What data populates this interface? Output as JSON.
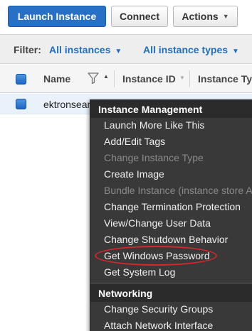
{
  "toolbar": {
    "launch_label": "Launch Instance",
    "connect_label": "Connect",
    "actions_label": "Actions",
    "actions_caret_icon": "chevron-down-icon"
  },
  "filter_bar": {
    "label": "Filter:",
    "instances_filter": "All instances",
    "types_filter": "All instance types",
    "chevron_icon": "chevron-down-icon"
  },
  "table": {
    "columns": [
      "Name",
      "Instance ID",
      "Instance Typ"
    ],
    "name_filter_icon": "funnel-icon",
    "rows": [
      {
        "name": "ektronsearch",
        "selected": true
      }
    ]
  },
  "context_menu": {
    "section_1": "Instance Management",
    "items_1": [
      {
        "label": "Launch More Like This",
        "enabled": true
      },
      {
        "label": "Add/Edit Tags",
        "enabled": true
      },
      {
        "label": "Change Instance Type",
        "enabled": false
      },
      {
        "label": "Create Image",
        "enabled": true
      },
      {
        "label": "Bundle Instance (instance store AMI)",
        "enabled": false
      },
      {
        "label": "Change Termination Protection",
        "enabled": true
      },
      {
        "label": "View/Change User Data",
        "enabled": true
      },
      {
        "label": "Change Shutdown Behavior",
        "enabled": true
      },
      {
        "label": "Get Windows Password",
        "enabled": true,
        "highlighted": true
      },
      {
        "label": "Get System Log",
        "enabled": true
      }
    ],
    "section_2": "Networking",
    "items_2": [
      {
        "label": "Change Security Groups",
        "enabled": true
      },
      {
        "label": "Attach Network Interface",
        "enabled": true
      }
    ]
  },
  "colors": {
    "primary_button": "#2870c6",
    "link": "#1f6fc5",
    "menu_bg": "#393939",
    "highlight_ring": "#d8262b"
  }
}
